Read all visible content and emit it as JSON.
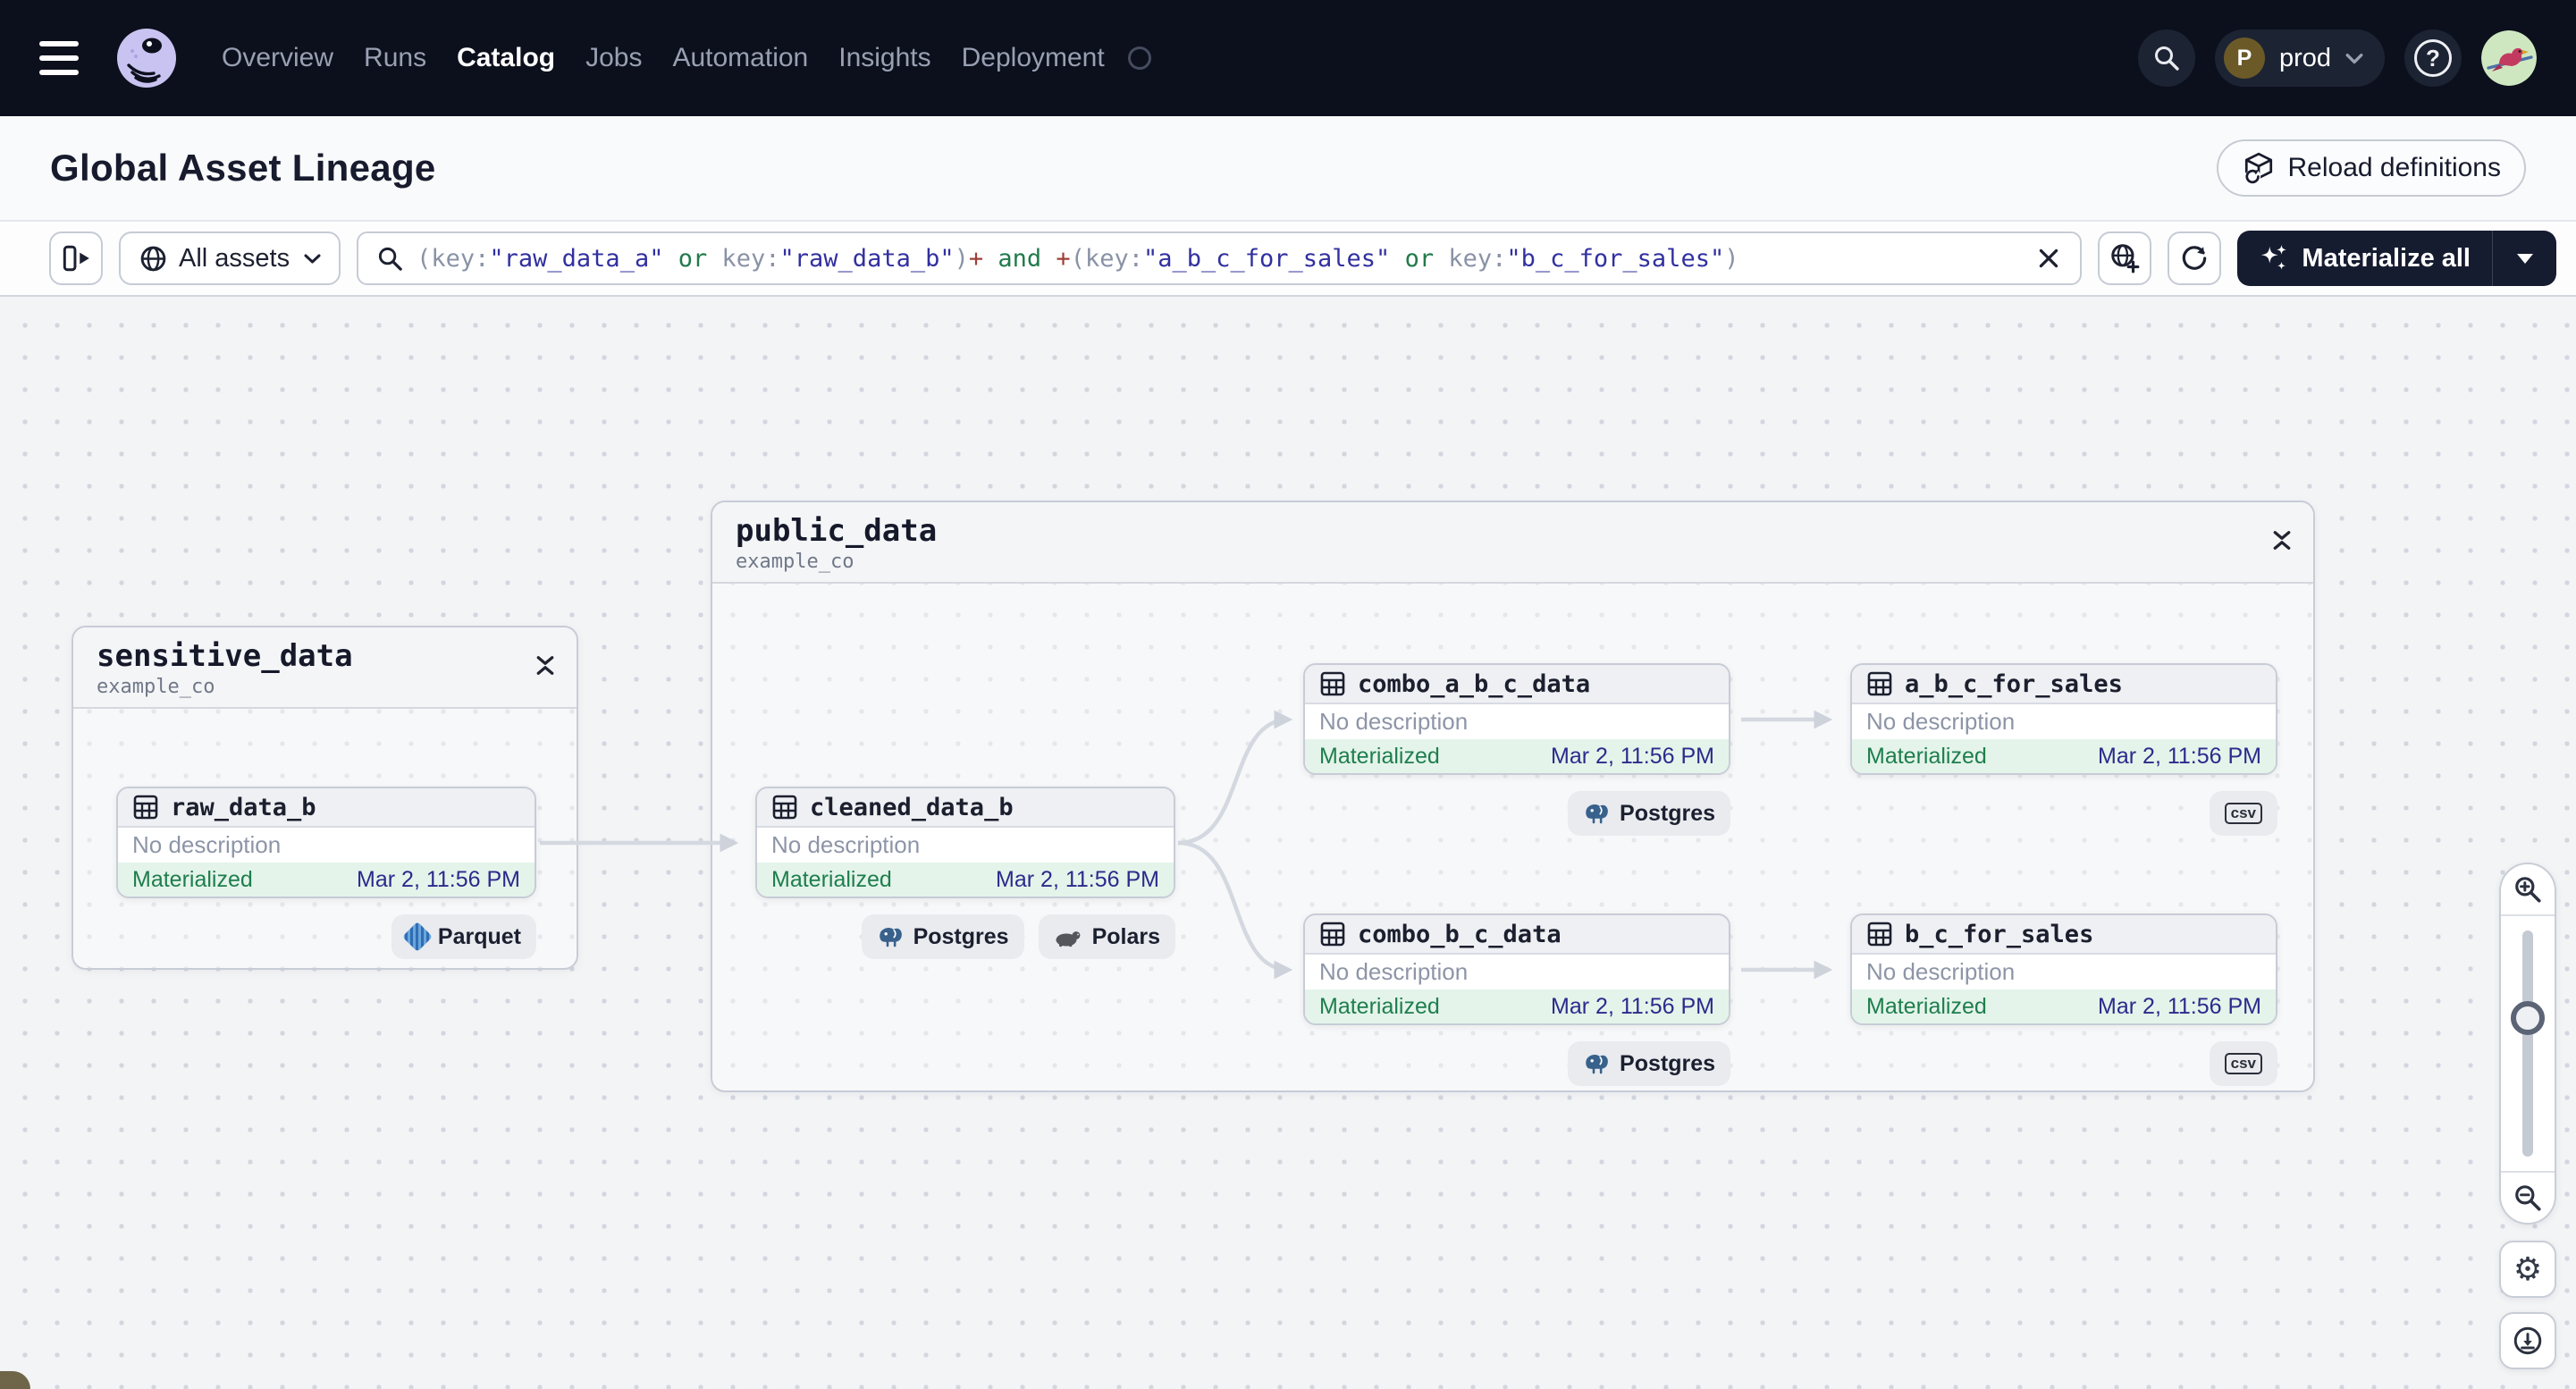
{
  "nav": {
    "items": [
      "Overview",
      "Runs",
      "Catalog",
      "Jobs",
      "Automation",
      "Insights",
      "Deployment"
    ],
    "active_item": "Catalog",
    "environment": {
      "initial": "P",
      "name": "prod"
    },
    "help_glyph": "?"
  },
  "header": {
    "title": "Global Asset Lineage",
    "reload_label": "Reload definitions"
  },
  "toolbar": {
    "scope_label": "All assets",
    "materialize_label": "Materialize all",
    "query": [
      "(key:",
      "\"raw_data_a\"",
      " or ",
      "key:",
      "\"raw_data_b\"",
      ")",
      "+",
      " and ",
      "+",
      "(key:",
      "\"a_b_c_for_sales\"",
      " or ",
      "key:",
      "\"b_c_for_sales\"",
      ")"
    ]
  },
  "graph": {
    "groups": [
      {
        "name": "sensitive_data",
        "repo": "example_co"
      },
      {
        "name": "public_data",
        "repo": "example_co"
      }
    ],
    "nodes": [
      {
        "title": "raw_data_b",
        "description": "No description",
        "status": "Materialized",
        "timestamp": "Mar 2, 11:56 PM",
        "badges": [
          {
            "icon": "parquet-icon",
            "label": "Parquet"
          }
        ]
      },
      {
        "title": "cleaned_data_b",
        "description": "No description",
        "status": "Materialized",
        "timestamp": "Mar 2, 11:56 PM",
        "badges": [
          {
            "icon": "postgres-icon",
            "label": "Postgres"
          },
          {
            "icon": "polars-icon",
            "label": "Polars"
          }
        ]
      },
      {
        "title": "combo_a_b_c_data",
        "description": "No description",
        "status": "Materialized",
        "timestamp": "Mar 2, 11:56 PM",
        "badges": [
          {
            "icon": "postgres-icon",
            "label": "Postgres"
          }
        ]
      },
      {
        "title": "a_b_c_for_sales",
        "description": "No description",
        "status": "Materialized",
        "timestamp": "Mar 2, 11:56 PM",
        "badges": [
          {
            "icon": "csv-icon",
            "label": "csv"
          }
        ]
      },
      {
        "title": "combo_b_c_data",
        "description": "No description",
        "status": "Materialized",
        "timestamp": "Mar 2, 11:56 PM",
        "badges": [
          {
            "icon": "postgres-icon",
            "label": "Postgres"
          }
        ]
      },
      {
        "title": "b_c_for_sales",
        "description": "No description",
        "status": "Materialized",
        "timestamp": "Mar 2, 11:56 PM",
        "badges": [
          {
            "icon": "csv-icon",
            "label": "csv"
          }
        ]
      }
    ]
  },
  "colors": {
    "nav_bg": "#0c101d",
    "status_green": "#1e7e4d",
    "timestamp_indigo": "#2b2b8c",
    "query_string": "#32309f",
    "query_operator": "#217a4b",
    "query_plus": "#9d3f36",
    "query_punct": "#8992a6",
    "edge": "#d4d8e0",
    "materialize_bg": "#161c30",
    "canvas_bg": "#f3f4f6"
  },
  "icons": {
    "menu": "hamburger",
    "brand": "dagster-octopus",
    "search": "magnifier",
    "help": "question-circle",
    "panel_toggle": "sidebar-expand",
    "scope": "globe",
    "clear": "x",
    "share_view": "globe-plus",
    "refresh": "sync-arrows",
    "materialize": "sparkles",
    "reload": "cube-refresh",
    "asset": "table-grid",
    "collapse": "collapse-chevrons",
    "zoom_in": "magnifier-plus",
    "zoom_out": "magnifier-minus",
    "settings": "gear",
    "download": "download-circle"
  }
}
